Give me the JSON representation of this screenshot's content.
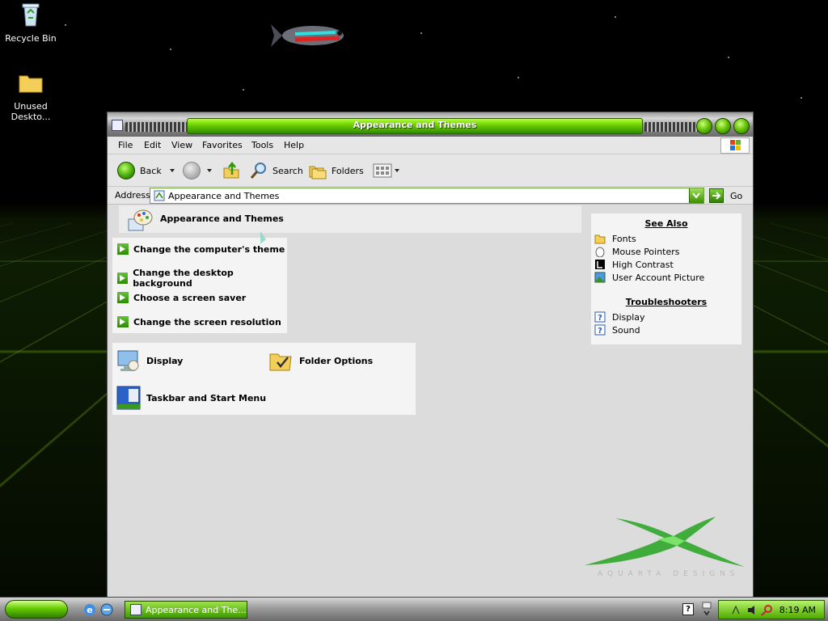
{
  "desktop": {
    "icons": [
      {
        "label": "Recycle Bin",
        "icon": "recycle-bin-icon"
      },
      {
        "label": "Unused Deskto...",
        "icon": "folder-icon"
      }
    ]
  },
  "window": {
    "title": "Appearance and Themes",
    "menu": [
      "File",
      "Edit",
      "View",
      "Favorites",
      "Tools",
      "Help"
    ],
    "toolbar": {
      "back": "Back",
      "search": "Search",
      "folders": "Folders"
    },
    "address": {
      "label": "Address",
      "value": "Appearance and Themes",
      "go": "Go"
    },
    "header": "Appearance and Themes",
    "tasks": [
      "Change the computer's theme",
      "Change the desktop background",
      "Choose a screen saver",
      "Change the screen resolution"
    ],
    "control_panel_icons": [
      {
        "label": "Display",
        "icon": "display-icon"
      },
      {
        "label": "Folder Options",
        "icon": "folder-options-icon"
      },
      {
        "label": "Taskbar and Start Menu",
        "icon": "taskbar-icon"
      }
    ],
    "see_also": {
      "title": "See Also",
      "items": [
        {
          "label": "Fonts",
          "icon": "fonts-folder-icon"
        },
        {
          "label": "Mouse Pointers",
          "icon": "mouse-icon"
        },
        {
          "label": "High Contrast",
          "icon": "contrast-icon"
        },
        {
          "label": "User Account Picture",
          "icon": "user-picture-icon"
        }
      ]
    },
    "troubleshooters": {
      "title": "Troubleshooters",
      "items": [
        {
          "label": "Display",
          "icon": "help-icon"
        },
        {
          "label": "Sound",
          "icon": "help-icon"
        }
      ]
    },
    "brand_watermark": "AQUARTA DESIGNS"
  },
  "taskbar": {
    "task_button": "Appearance and The...",
    "clock": "8:19 AM"
  },
  "colors": {
    "accent_green": "#5fbf00",
    "window_bg": "#dcdcdc",
    "desktop_bg": "#000000"
  }
}
